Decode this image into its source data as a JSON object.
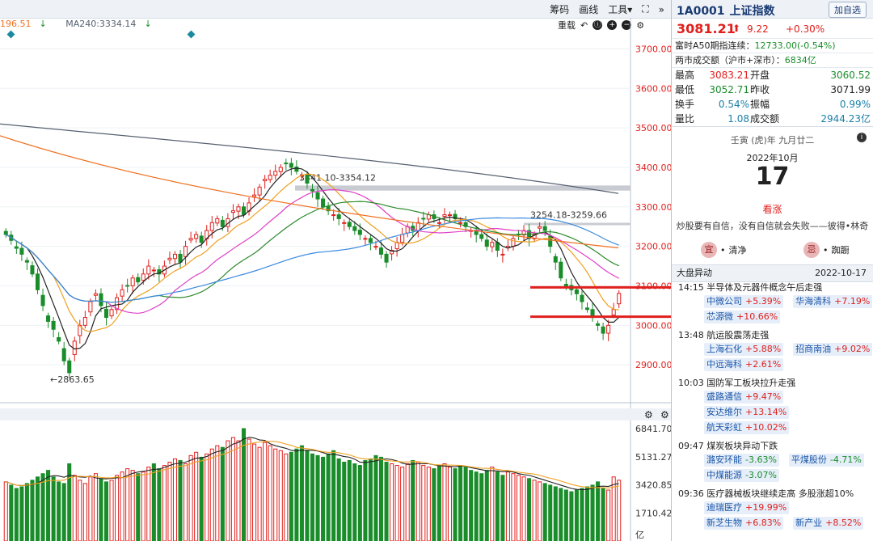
{
  "toolbar": {
    "chip_label": "筹码",
    "draw_label": "画线",
    "tools_label": "工具",
    "tools_arrow": "▾",
    "expand_glyph": "⛶",
    "more_glyph": "»"
  },
  "ma_row": {
    "ma120": "196.51",
    "ma120_arrow": "↓",
    "ma240": "MA240:3334.14",
    "ma240_arrow": "↓"
  },
  "subtools": {
    "reload_label": "重载"
  },
  "price_axis": [
    "3700.00",
    "3600.00",
    "3500.00",
    "3400.00",
    "3300.00",
    "3200.00",
    "3100.00",
    "3000.00",
    "2900.00"
  ],
  "volume_axis": [
    "6841.70",
    "5131.27",
    "3420.85",
    "1710.42"
  ],
  "volume_unit": "亿",
  "annotations": {
    "low_label": "←2863.65",
    "range1": "3341.10-3354.12",
    "range2": "3254.18-3259.66"
  },
  "colors": {
    "up": "#e0201d",
    "down": "#1a8d2b",
    "ma5": "#222222",
    "ma10": "#f0a020",
    "ma20": "#e040c8",
    "ma30": "#2b8a2b",
    "ma60": "#3c8ae0",
    "ma120": "#f07020",
    "ma240": "#556070",
    "hline": "#e0201d",
    "accent": "#1a3a73"
  },
  "chart_data": {
    "type": "candlestick",
    "price_ylim": [
      2800,
      3750
    ],
    "low_marker": 2863.65,
    "highlight_ranges": [
      [
        3341.1,
        3354.12
      ],
      [
        3254.18,
        3259.66
      ]
    ],
    "horizontal_lines": [
      3096,
      3022
    ],
    "volume_ylim": [
      0,
      6841.7
    ],
    "closes": [
      3230,
      3215,
      3195,
      3180,
      3160,
      3130,
      3090,
      3050,
      3010,
      2990,
      2960,
      2910,
      2880,
      2960,
      3000,
      3020,
      3060,
      3080,
      3050,
      3020,
      3040,
      3070,
      3090,
      3100,
      3120,
      3110,
      3130,
      3150,
      3140,
      3130,
      3150,
      3170,
      3180,
      3160,
      3200,
      3220,
      3230,
      3210,
      3240,
      3260,
      3270,
      3250,
      3270,
      3290,
      3300,
      3280,
      3310,
      3330,
      3350,
      3370,
      3380,
      3390,
      3400,
      3410,
      3400,
      3390,
      3380,
      3360,
      3340,
      3320,
      3300,
      3290,
      3280,
      3270,
      3260,
      3250,
      3240,
      3230,
      3220,
      3210,
      3200,
      3180,
      3160,
      3190,
      3210,
      3230,
      3250,
      3240,
      3260,
      3270,
      3280,
      3270,
      3260,
      3280,
      3280,
      3270,
      3260,
      3250,
      3240,
      3230,
      3220,
      3200,
      3210,
      3190,
      3180,
      3200,
      3220,
      3230,
      3240,
      3220,
      3230,
      3250,
      3240,
      3200,
      3160,
      3120,
      3100,
      3090,
      3080,
      3060,
      3040,
      3020,
      3000,
      2980,
      3000,
      3040,
      3081
    ],
    "volumes": [
      3600,
      3400,
      3200,
      3300,
      3500,
      3700,
      3900,
      4100,
      4300,
      3900,
      3600,
      3500,
      4700,
      4000,
      3700,
      3500,
      3900,
      4100,
      3800,
      3600,
      3700,
      4000,
      4200,
      4400,
      4300,
      4100,
      4200,
      4500,
      4700,
      4400,
      4600,
      4800,
      5000,
      4900,
      4700,
      5200,
      5400,
      5100,
      5300,
      5600,
      5800,
      5700,
      6100,
      6300,
      6100,
      6841,
      6200,
      5900,
      5700,
      6000,
      5800,
      5600,
      5500,
      5300,
      5400,
      5600,
      5800,
      5500,
      5300,
      5200,
      5100,
      5300,
      5500,
      5000,
      4800,
      4900,
      4700,
      4600,
      4900,
      5000,
      5200,
      5100,
      4800,
      4700,
      4600,
      4500,
      4700,
      4900,
      4800,
      4600,
      4500,
      4400,
      4600,
      4700,
      4500,
      4400,
      4600,
      4500,
      4300,
      4200,
      4100,
      4300,
      4500,
      4200,
      4000,
      4200,
      4100,
      4000,
      3900,
      3800,
      3700,
      3600,
      3500,
      3400,
      3300,
      3200,
      3100,
      3000,
      3100,
      3200,
      3300,
      3400,
      3600,
      3200,
      3100,
      3900,
      3700
    ]
  },
  "quote": {
    "code": "1A0001",
    "name": "上证指数",
    "add_btn": "加自选",
    "price": "3081.21",
    "arrow": "⬆",
    "change": "9.22",
    "pct": "+0.30%",
    "a50_label": "富时A50期指连续：",
    "a50_value": "12733.00(-0.54%)",
    "turnover_label": "两市成交额（沪市+深市）：",
    "turnover_value": "6834亿",
    "stats": [
      {
        "l1": "最高",
        "v1": "3083.21",
        "c1": "red",
        "l2": "开盘",
        "v2": "3060.52",
        "c2": "green"
      },
      {
        "l1": "最低",
        "v1": "3052.71",
        "c1": "green",
        "l2": "昨收",
        "v2": "3071.99",
        "c2": ""
      },
      {
        "l1": "换手",
        "v1": "0.54%",
        "c1": "teal",
        "l2": "振幅",
        "v2": "0.99%",
        "c2": "teal"
      },
      {
        "l1": "量比",
        "v1": "1.08",
        "c1": "teal",
        "l2": "成交额",
        "v2": "2944.23亿",
        "c2": "teal"
      }
    ]
  },
  "calendar": {
    "lunar": "壬寅 (虎)年 九月廿二",
    "year_month": "2022年10月",
    "day": "17",
    "kanzhang": "看涨",
    "quote": "炒股要有自信，没有自信就会失败——彼得•林奇",
    "yi": "宜",
    "yi_text": "清净",
    "ji": "忌",
    "ji_text": "踟蹰"
  },
  "events_header": {
    "title": "大盘异动",
    "date": "2022-10-17"
  },
  "events": [
    {
      "time": "14:15",
      "title": "半导体及元器件概念午后走强",
      "stocks": [
        {
          "name": "中微公司",
          "pct": "+5.39%"
        },
        {
          "name": "华海清科",
          "pct": "+7.19%"
        },
        {
          "name": "芯源微",
          "pct": "+10.66%"
        }
      ]
    },
    {
      "time": "13:48",
      "title": "航运股震荡走强",
      "stocks": [
        {
          "name": "上海石化",
          "pct": "+5.88%"
        },
        {
          "name": "招商南油",
          "pct": "+9.02%"
        },
        {
          "name": "中远海科",
          "pct": "+2.61%"
        }
      ]
    },
    {
      "time": "10:03",
      "title": "国防军工板块拉升走强",
      "stocks": [
        {
          "name": "盛路通信",
          "pct": "+9.47%"
        },
        {
          "name": "安达维尔",
          "pct": "+13.14%"
        },
        {
          "name": "航天彩虹",
          "pct": "+10.02%"
        }
      ]
    },
    {
      "time": "09:47",
      "title": "煤炭板块异动下跌",
      "stocks": [
        {
          "name": "潞安环能",
          "pct": "-3.63%"
        },
        {
          "name": "平煤股份",
          "pct": "-4.71%"
        },
        {
          "name": "中煤能源",
          "pct": "-3.07%"
        }
      ]
    },
    {
      "time": "09:36",
      "title": "医疗器械板块继续走高 多股涨超10%",
      "stocks": [
        {
          "name": "迪瑞医疗",
          "pct": "+19.99%"
        },
        {
          "name": "新芝生物",
          "pct": "+6.83%"
        },
        {
          "name": "新产业",
          "pct": "+8.52%"
        }
      ]
    }
  ]
}
